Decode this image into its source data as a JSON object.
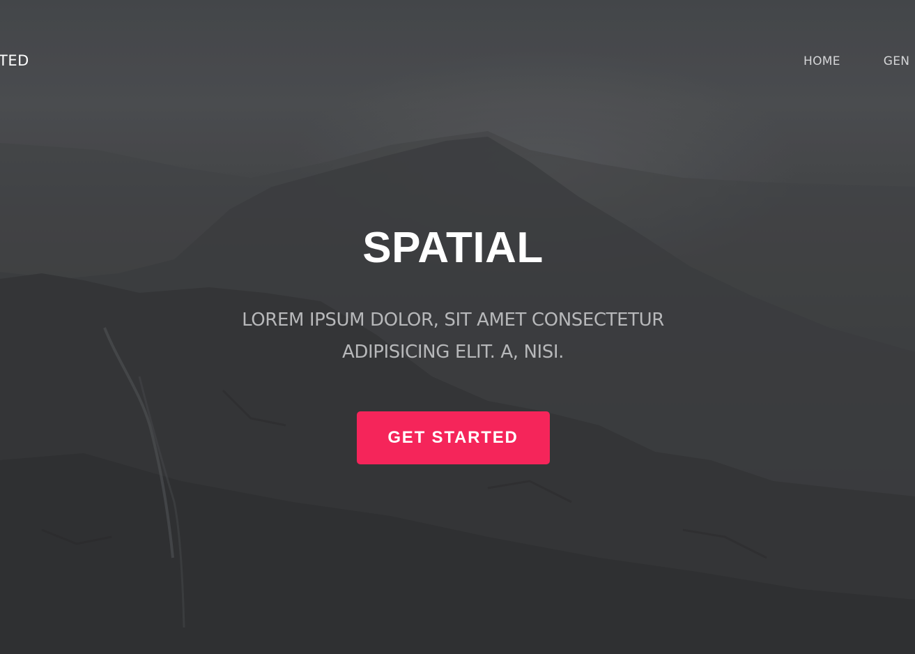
{
  "nav": {
    "brand": "TED",
    "links": [
      {
        "label": "HOME"
      },
      {
        "label": "GEN"
      }
    ]
  },
  "hero": {
    "title": "SPATIAL",
    "subtitle": "LOREM IPSUM DOLOR, SIT AMET CONSECTETUR ADIPISICING ELIT. A, NISI.",
    "cta_label": "GET STARTED"
  },
  "colors": {
    "accent": "#f5255a",
    "overlay": "#3f4144",
    "title_text": "#ffffff",
    "subtitle_text": "#b7b8ba"
  }
}
